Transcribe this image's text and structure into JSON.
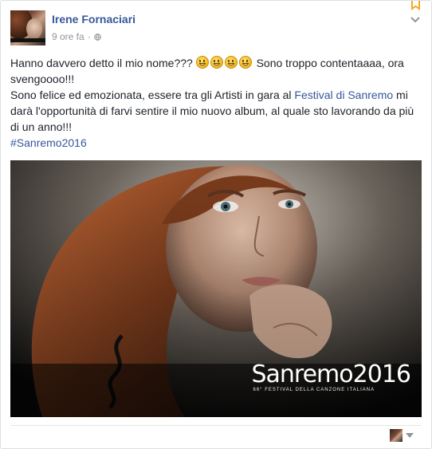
{
  "post": {
    "author": "Irene Fornaciari",
    "time": "9 ore fa",
    "separator": "·",
    "text_line1_a": "Hanno davvero detto il mio nome???",
    "text_line1_b": "Sono troppo contentaaaa, ora svengoooo!!!",
    "text_line2_a": "Sono felice ed emozionata, essere tra gli Artisti in gara al",
    "text_link": "Festival di Sanremo",
    "text_line2_b": "mi darà l'opportunità di farvi sentire il mio nuovo album, al quale sto lavorando da più di un anno!!!",
    "hashtag": "#Sanremo2016",
    "emoji_count": 4
  },
  "image": {
    "brand_word": "Sanremo",
    "brand_year": "2016",
    "brand_sub": "66° FESTIVAL DELLA CANZONE ITALIANA"
  },
  "icons": {
    "bookmark": "bookmark-icon",
    "chevron": "chevron-down-icon",
    "globe": "globe-icon",
    "share_arrow": "caret-down-icon"
  },
  "colors": {
    "link": "#365899",
    "meta": "#90949c",
    "text": "#1d2129",
    "bookmark": "#f5a623"
  }
}
